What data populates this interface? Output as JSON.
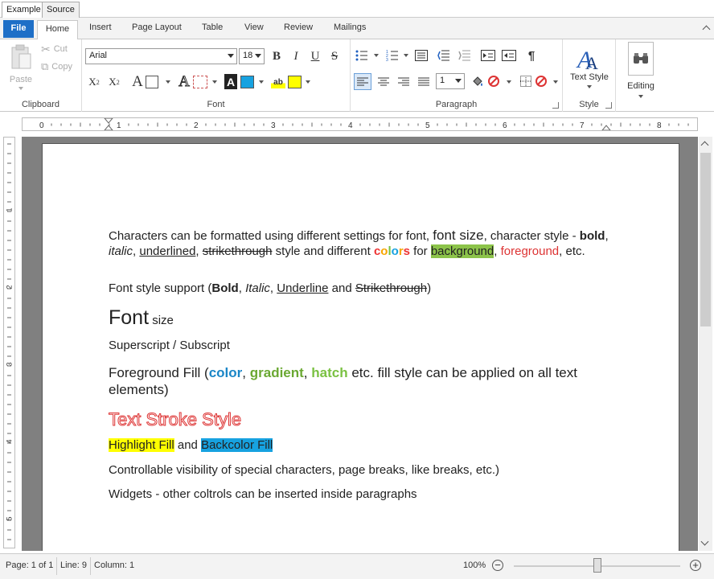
{
  "top_tabs": [
    "Example",
    "Source"
  ],
  "ribbon_tabs": {
    "file": "File",
    "home": "Home",
    "insert": "Insert",
    "page_layout": "Page Layout",
    "table": "Table",
    "view": "View",
    "review": "Review",
    "mailings": "Mailings"
  },
  "clipboard": {
    "paste": "Paste",
    "cut": "Cut",
    "copy": "Copy",
    "label": "Clipboard"
  },
  "font": {
    "family": "Arial",
    "size": "18",
    "label": "Font"
  },
  "paragraph": {
    "line_spacing": "1",
    "label": "Paragraph"
  },
  "style": {
    "text_style": "Text Style",
    "label": "Style"
  },
  "editing": {
    "label": "Editing"
  },
  "ruler_numbers": [
    "0",
    "1",
    "2",
    "3",
    "4",
    "5",
    "6",
    "7",
    "8"
  ],
  "ruler_v_numbers": [
    "1",
    "2",
    "3",
    "4",
    "5"
  ],
  "doc": {
    "p1": {
      "a": "Characters can be formatted using different settings for font, ",
      "font_size": "font size",
      "b": ", character style - ",
      "bold": "bold",
      "c1": ", ",
      "italic": "italic",
      "c2": ", ",
      "underlined": "underlined",
      "c3": ", ",
      "strike": "strikethrough",
      "d": " style and different ",
      "colors": [
        "c",
        "o",
        "l",
        "o",
        "r",
        "s"
      ],
      "e": " for ",
      "background": "background",
      "f": ", ",
      "foreground": "foreground",
      "g": ", etc."
    },
    "p2": {
      "a": "Font style support (",
      "bold": "Bold",
      "c1": ", ",
      "italic": "Italic",
      "c2": ", ",
      "underline": "Underline",
      "and": " and ",
      "strike": "Strikethrough",
      "end": ")"
    },
    "p3": {
      "font": "Font",
      "size": " size"
    },
    "p4": {
      "text": "Superscript / Subscript"
    },
    "p5": {
      "a": "Foreground Fill (",
      "color": "color",
      "c1": ", ",
      "gradient": "gradient",
      "c2": ", ",
      "hatch": "hatch",
      "b": " etc. fill style can be applied on all text elements)"
    },
    "p6": {
      "text": "Text Stroke Style"
    },
    "p7": {
      "highlight": "Highlight Fill",
      "and": " and ",
      "backcolor": "Backcolor Fill"
    },
    "p8": {
      "text": "Controllable visibility of special characters, page breaks, like breaks, etc.)"
    },
    "p9": {
      "text": "Widgets - other coltrols can be inserted inside paragraphs"
    }
  },
  "status": {
    "page": "Page: 1 of 1",
    "line": "Line: 9",
    "column": "Column: 1",
    "zoom": "100%"
  },
  "zoom_level": 1.0
}
